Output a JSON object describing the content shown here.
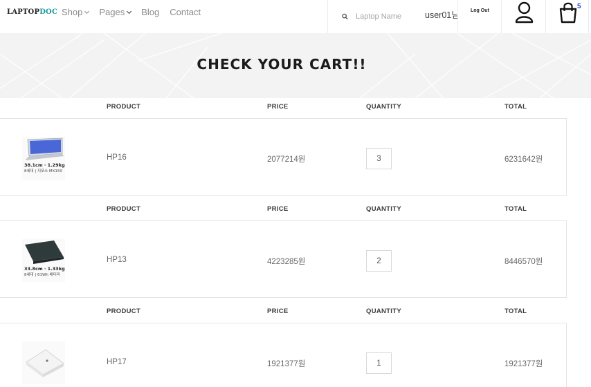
{
  "header": {
    "logo_main": "LAPTOP",
    "logo_accent": "DOC",
    "nav": [
      {
        "label": "Shop",
        "has_dropdown": true
      },
      {
        "label": "Pages",
        "has_dropdown": true
      },
      {
        "label": "Blog",
        "has_dropdown": false
      },
      {
        "label": "Contact",
        "has_dropdown": false
      }
    ],
    "search_placeholder": "Laptop Name",
    "username": "user01님",
    "logout_label": "Log Out",
    "cart_count": "5",
    "icons": {
      "search": "search-icon",
      "user": "user-icon",
      "cart": "shopping-bag-icon"
    },
    "accent_color": "#1a9a9a",
    "cart_count_color": "#1e3fd1"
  },
  "banner": {
    "title": "CHECK YOUR CART!!"
  },
  "cart": {
    "headers": {
      "product": "PRODUCT",
      "price": "PRICE",
      "quantity": "QUANTITY",
      "total": "TOTAL"
    },
    "items": [
      {
        "name": "HP16",
        "price": "2077214원",
        "quantity": "3",
        "total": "6231642원",
        "thumb_caption_1": "38.1cm · 1.29kg",
        "thumb_caption_2": "8세대 | 지포스 MX150",
        "laptop_color": "#c8cdd6"
      },
      {
        "name": "HP13",
        "price": "4223285원",
        "quantity": "2",
        "total": "8446570원",
        "thumb_caption_1": "33.8cm · 1.33kg",
        "thumb_caption_2": "8세대 | 61Wh 배터리",
        "laptop_color": "#2f3a3a"
      },
      {
        "name": "HP17",
        "price": "1921377원",
        "quantity": "1",
        "total": "1921377원",
        "thumb_caption_1": "",
        "thumb_caption_2": "",
        "laptop_color": "#f2f2f2"
      }
    ]
  }
}
